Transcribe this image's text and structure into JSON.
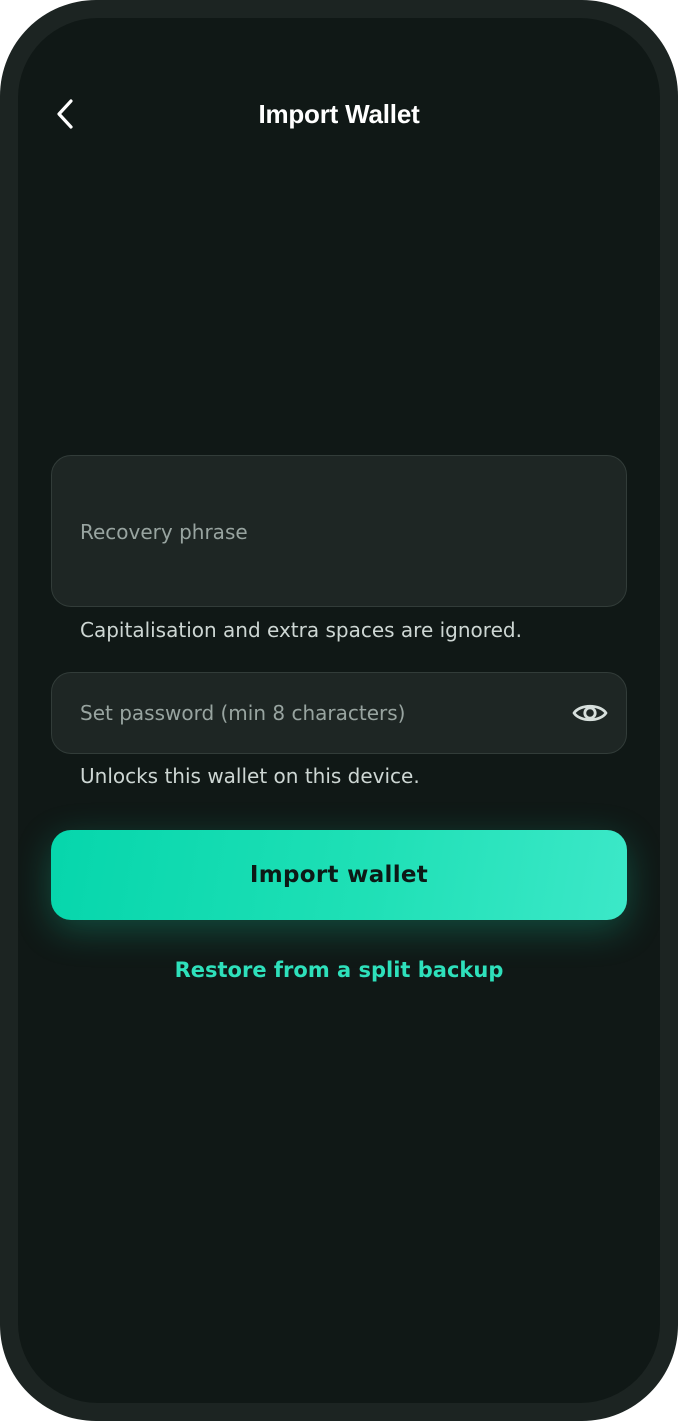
{
  "header": {
    "back_icon": "chevron-left-icon",
    "title": "Import Wallet"
  },
  "form": {
    "recovery": {
      "placeholder": "Recovery phrase",
      "value": "",
      "helper": "Capitalisation and extra spaces are ignored."
    },
    "password": {
      "placeholder": "Set password (min 8 characters)",
      "value": "",
      "helper": "Unlocks this wallet on this device.",
      "toggle_icon": "eye-icon"
    }
  },
  "actions": {
    "import_label": "Import wallet",
    "restore_label": "Restore from a split backup"
  },
  "colors": {
    "background": "#101816",
    "field_background": "#1e2624",
    "accent": "#13dcb1",
    "link": "#2ee0bb",
    "title": "#ffffff"
  }
}
